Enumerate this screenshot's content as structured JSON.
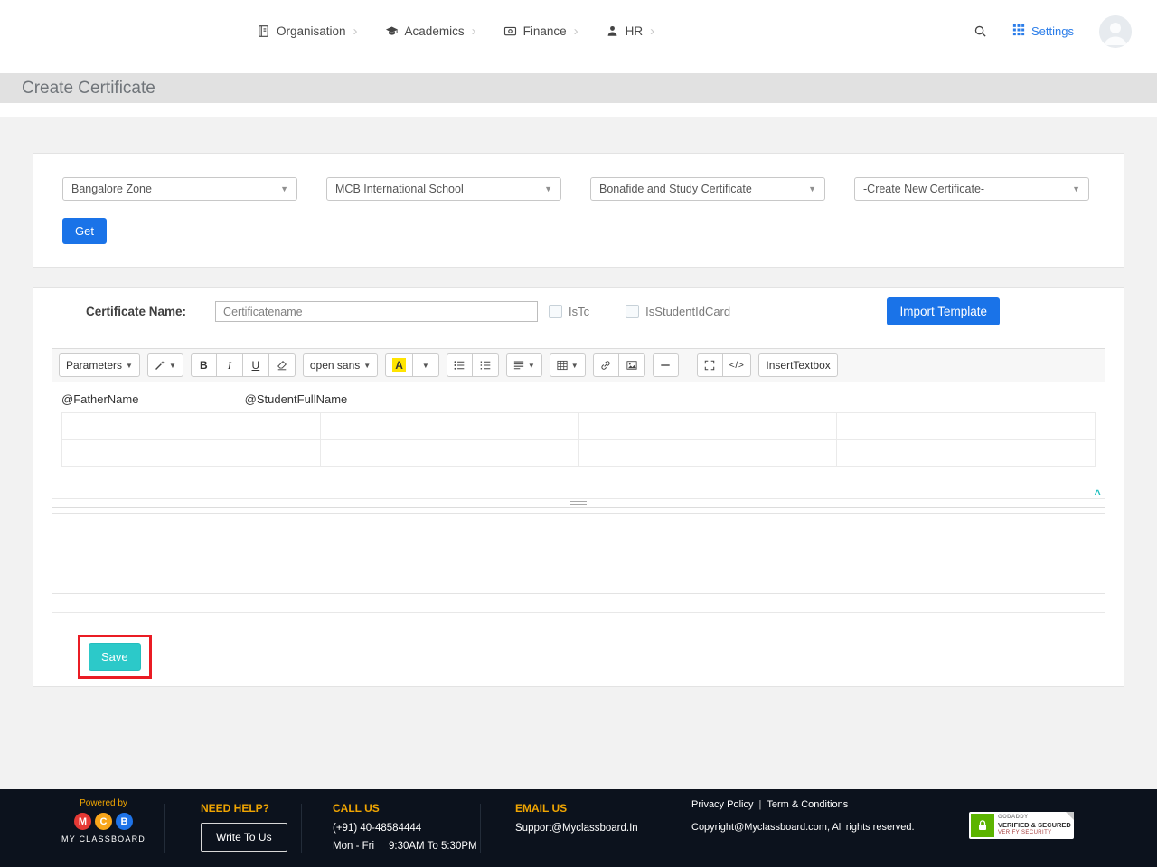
{
  "navbar": {
    "items": [
      {
        "label": "Organisation"
      },
      {
        "label": "Academics"
      },
      {
        "label": "Finance"
      },
      {
        "label": "HR"
      }
    ],
    "settings_label": "Settings"
  },
  "page_title": "Create Certificate",
  "filters": {
    "zone": "Bangalore Zone",
    "school": "MCB International School",
    "certificate_type": "Bonafide and Study Certificate",
    "certificate": "-Create New Certificate-",
    "get_button": "Get"
  },
  "certificate_form": {
    "name_label": "Certificate Name:",
    "name_value": "Certificatename",
    "istc_label": "IsTc",
    "isstudentidcard_label": "IsStudentIdCard",
    "import_button": "Import Template"
  },
  "editor": {
    "toolbar": {
      "parameters": "Parameters",
      "bold": "B",
      "italic": "I",
      "underline": "U",
      "font_name": "open sans",
      "color_letter": "A",
      "code_view": "</>",
      "insert_textbox": "InsertTextbox"
    },
    "tokens": {
      "father": "@FatherName",
      "student": "@StudentFullName"
    }
  },
  "save_button": "Save",
  "footer": {
    "powered_by": "Powered by",
    "logo": {
      "m": "M",
      "c": "C",
      "b": "B"
    },
    "brand": "MY CLASSBOARD",
    "need_help_title": "NEED HELP?",
    "write_to_us": "Write To Us",
    "call_us_title": "CALL US",
    "phone": "(+91) 40-48584444",
    "days": "Mon - Fri",
    "hours": "9:30AM To 5:30PM",
    "email_title": "EMAIL US",
    "email": "Support@Myclassboard.In",
    "privacy": "Privacy Policy",
    "separator": "|",
    "terms": "Term & Conditions",
    "copyright": "Copyright@Myclassboard.com, All rights reserved.",
    "badge_brand": "GODADDY",
    "badge_line1": "VERIFIED & SECURED",
    "badge_line2": "VERIFY SECURITY"
  },
  "colors": {
    "primary_blue": "#1a73e8",
    "save_teal": "#2cc9c9",
    "annotation_red": "#ea1c24",
    "footer_orange": "#f0a502",
    "footer_bg": "#0c121d",
    "highlight_yellow": "#ffe400"
  }
}
